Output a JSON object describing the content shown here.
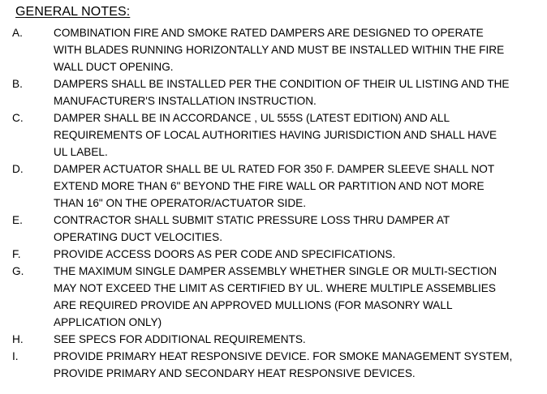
{
  "title": "GENERAL NOTES:",
  "notes": [
    {
      "letter": "A.",
      "lines": [
        "COMBINATION FIRE AND SMOKE RATED DAMPERS ARE DESIGNED TO OPERATE",
        "WITH BLADES RUNNING HORIZONTALLY AND MUST BE INSTALLED WITHIN THE FIRE",
        "WALL DUCT OPENING."
      ]
    },
    {
      "letter": "B.",
      "lines": [
        "DAMPERS SHALL BE INSTALLED PER THE CONDITION OF THEIR UL LISTING AND THE",
        "MANUFACTURER'S INSTALLATION INSTRUCTION."
      ]
    },
    {
      "letter": "C.",
      "lines": [
        "DAMPER SHALL BE IN ACCORDANCE , UL 555S (LATEST EDITION) AND ALL",
        "REQUIREMENTS OF LOCAL AUTHORITIES HAVING JURISDICTION AND SHALL HAVE",
        "UL LABEL."
      ]
    },
    {
      "letter": "D.",
      "lines": [
        "DAMPER ACTUATOR SHALL BE UL RATED FOR 350  F. DAMPER SLEEVE SHALL NOT",
        "EXTEND MORE THAN 6\" BEYOND THE FIRE WALL OR PARTITION AND NOT MORE",
        "THAN 16\" ON THE OPERATOR/ACTUATOR SIDE."
      ]
    },
    {
      "letter": "E.",
      "lines": [
        "CONTRACTOR SHALL SUBMIT STATIC PRESSURE LOSS THRU DAMPER AT",
        "OPERATING DUCT VELOCITIES."
      ]
    },
    {
      "letter": "F.",
      "lines": [
        "PROVIDE ACCESS DOORS AS PER CODE AND SPECIFICATIONS."
      ]
    },
    {
      "letter": "G.",
      "lines": [
        "THE MAXIMUM SINGLE DAMPER ASSEMBLY WHETHER SINGLE OR MULTI-SECTION",
        "MAY NOT EXCEED THE LIMIT AS CERTIFIED BY UL. WHERE MULTIPLE ASSEMBLIES",
        "ARE REQUIRED PROVIDE AN APPROVED MULLIONS (FOR MASONRY WALL",
        "APPLICATION ONLY)"
      ]
    },
    {
      "letter": "H.",
      "lines": [
        "SEE SPECS FOR ADDITIONAL REQUIREMENTS."
      ]
    },
    {
      "letter": "I.",
      "lines": [
        "PROVIDE PRIMARY HEAT RESPONSIVE DEVICE. FOR SMOKE MANAGEMENT SYSTEM,",
        "PROVIDE PRIMARY AND SECONDARY HEAT RESPONSIVE DEVICES."
      ]
    }
  ]
}
